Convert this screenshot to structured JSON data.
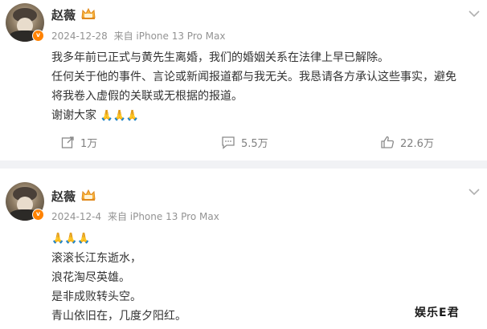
{
  "posts": [
    {
      "username": "赵薇",
      "date": "2024-12-28",
      "source": "来自 iPhone 13 Pro Max",
      "lines": [
        "我多年前已正式与黄先生离婚，我们的婚姻关系在法律上早已解除。",
        "任何关于他的事件、言论或新闻报道都与我无关。我恳请各方承认这些事实，避免",
        "将我卷入虚假的关联或无根据的报道。",
        "谢谢大家"
      ],
      "emoji_count": 3,
      "stats": {
        "reposts": "1万",
        "comments": "5.5万",
        "likes": "22.6万"
      }
    },
    {
      "username": "赵薇",
      "date": "2024-12-4",
      "source": "来自 iPhone 13 Pro Max",
      "emoji_count": 3,
      "lines": [
        "滚滚长江东逝水，",
        "浪花淘尽英雄。",
        "是非成败转头空。",
        "青山依旧在，几度夕阳红。"
      ]
    }
  ],
  "watermark": "娱乐E君",
  "icons": {
    "verified": "verified-badge-icon",
    "crown": "crown-member-icon",
    "more": "chevron-down-icon",
    "repost": "repost-icon",
    "comment": "comment-icon",
    "like": "thumbs-up-icon",
    "emoji": "folded-hands-emoji"
  },
  "colors": {
    "accent": "#ff8200",
    "meta": "#939393",
    "text": "#333333",
    "divider": "#f1f2f5"
  }
}
